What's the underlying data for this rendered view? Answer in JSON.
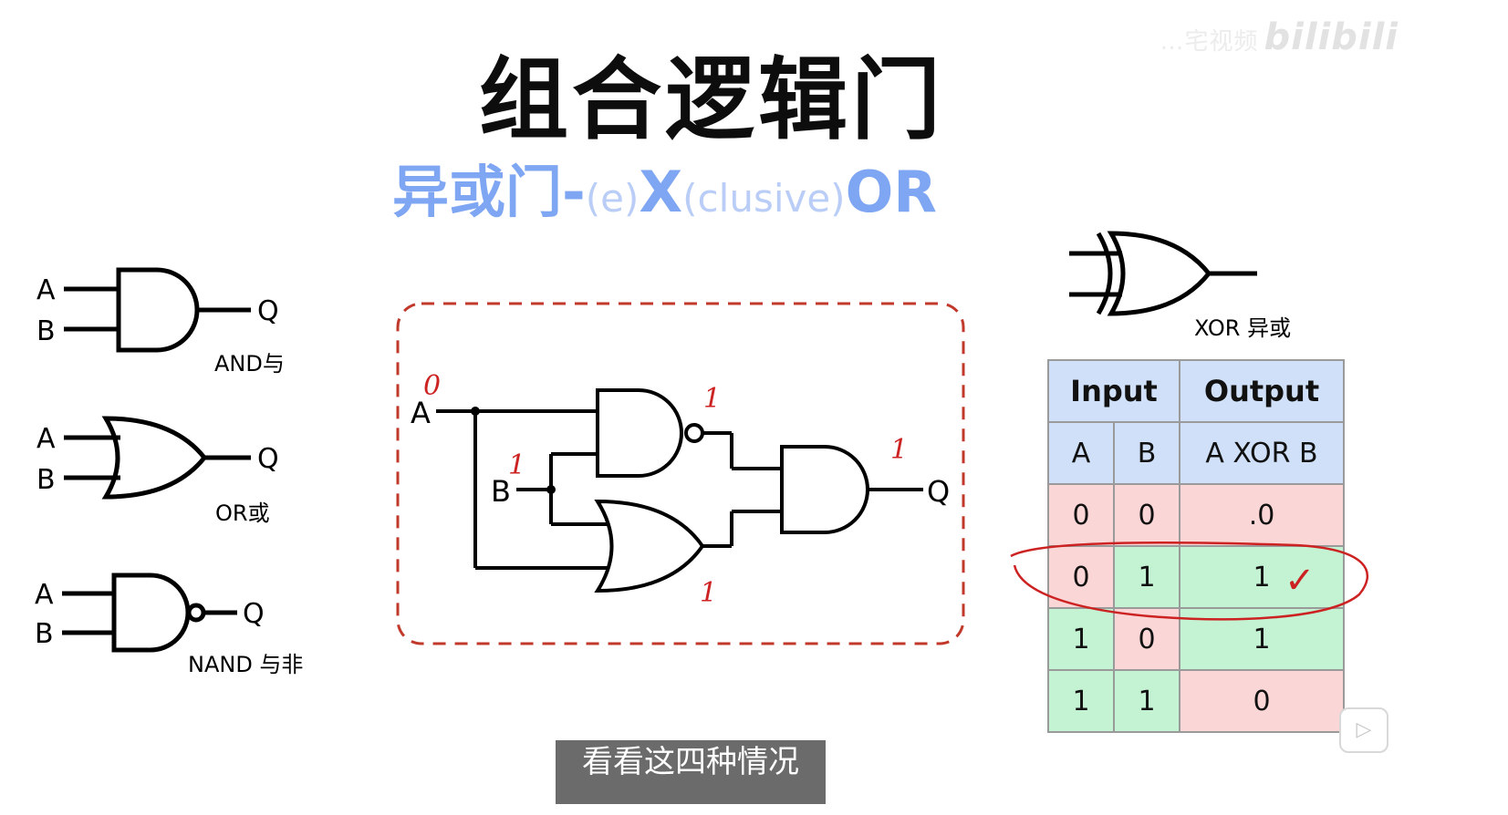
{
  "title": "组合逻辑门",
  "subtitle": {
    "part1": "异或门-",
    "part2": "(e)",
    "part3": "X",
    "part4": "(clusive)",
    "part5": "OR"
  },
  "watermark": {
    "prefix": "…宅视频",
    "brand": "bilibili"
  },
  "gates": {
    "and": {
      "in_a": "A",
      "in_b": "B",
      "out": "Q",
      "caption": "AND与"
    },
    "or": {
      "in_a": "A",
      "in_b": "B",
      "out": "Q",
      "caption": "OR或"
    },
    "nand": {
      "in_a": "A",
      "in_b": "B",
      "out": "Q",
      "caption": "NAND 与非"
    }
  },
  "circuit": {
    "in_a": "A",
    "in_b": "B",
    "out": "Q",
    "handwritten": {
      "a_value": "0",
      "b_value": "1",
      "nand_value": "1",
      "or_value": "1",
      "q_value": "1"
    }
  },
  "xor_symbol": {
    "caption": "XOR 异或"
  },
  "truth_table": {
    "headers": {
      "input": "Input",
      "output": "Output"
    },
    "subheaders": {
      "a": "A",
      "b": "B",
      "out": "A XOR B"
    },
    "rows": [
      {
        "a": "0",
        "b": "0",
        "out": ".0",
        "out_color": "pink"
      },
      {
        "a": "0",
        "b": "1",
        "out": "1",
        "out_color": "green"
      },
      {
        "a": "1",
        "b": "0",
        "out": "1",
        "out_color": "green"
      },
      {
        "a": "1",
        "b": "1",
        "out": "0",
        "out_color": "pink"
      }
    ],
    "check_mark": "✓"
  },
  "caption_bar": "看看这四种情况",
  "colors": {
    "subtitle": "#7fa6f2",
    "dashed_box": "#c0392b",
    "handwriting": "#cc2222",
    "header_bg": "#cfe0f8",
    "pink": "#fbd6d6",
    "green": "#c4f3d3"
  }
}
